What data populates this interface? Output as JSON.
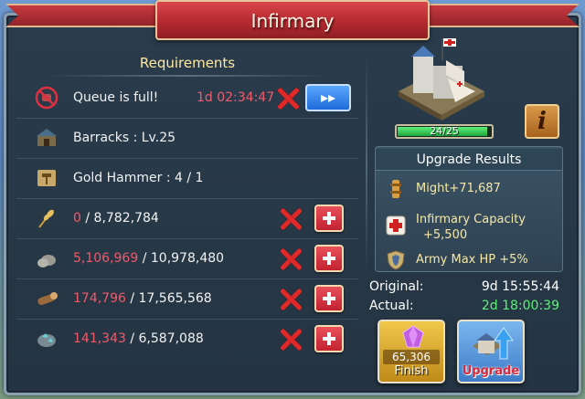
{
  "title": "Infirmary",
  "requirements": {
    "heading": "Requirements",
    "queue": {
      "label": "Queue is full!",
      "timer": "1d 02:34:47",
      "speedup_label": "▸▸"
    },
    "barracks": {
      "label": "Barracks : Lv.25"
    },
    "gold_hammer": {
      "label": "Gold Hammer : 4 / 1"
    },
    "resources": [
      {
        "icon": "wheat-icon",
        "have": "0",
        "need": " / 8,782,784"
      },
      {
        "icon": "stone-icon",
        "have": "5,106,969",
        "need": " / 10,978,480"
      },
      {
        "icon": "timber-icon",
        "have": "174,796",
        "need": " / 17,565,568"
      },
      {
        "icon": "ore-icon",
        "have": "141,343",
        "need": " / 6,587,088"
      }
    ]
  },
  "building": {
    "progress_text": "24/25",
    "progress_fraction": 0.96,
    "info_label": "i"
  },
  "upgrade_results": {
    "heading": "Upgrade Results",
    "might": "Might+71,687",
    "capacity_line1": "Infirmary Capacity",
    "capacity_line2": "+5,500",
    "army_hp": "Army Max HP +5%"
  },
  "times": {
    "original_label": "Original:",
    "original_value": "9d 15:55:44",
    "actual_label": "Actual:",
    "actual_value": "2d 18:00:39"
  },
  "buttons": {
    "finish_cost": "65,306",
    "finish_label": "Finish",
    "upgrade_label": "Upgrade"
  },
  "colors": {
    "missing": "#f05a6a",
    "actual_time": "#5ef07a",
    "accent_red": "#c22230"
  }
}
